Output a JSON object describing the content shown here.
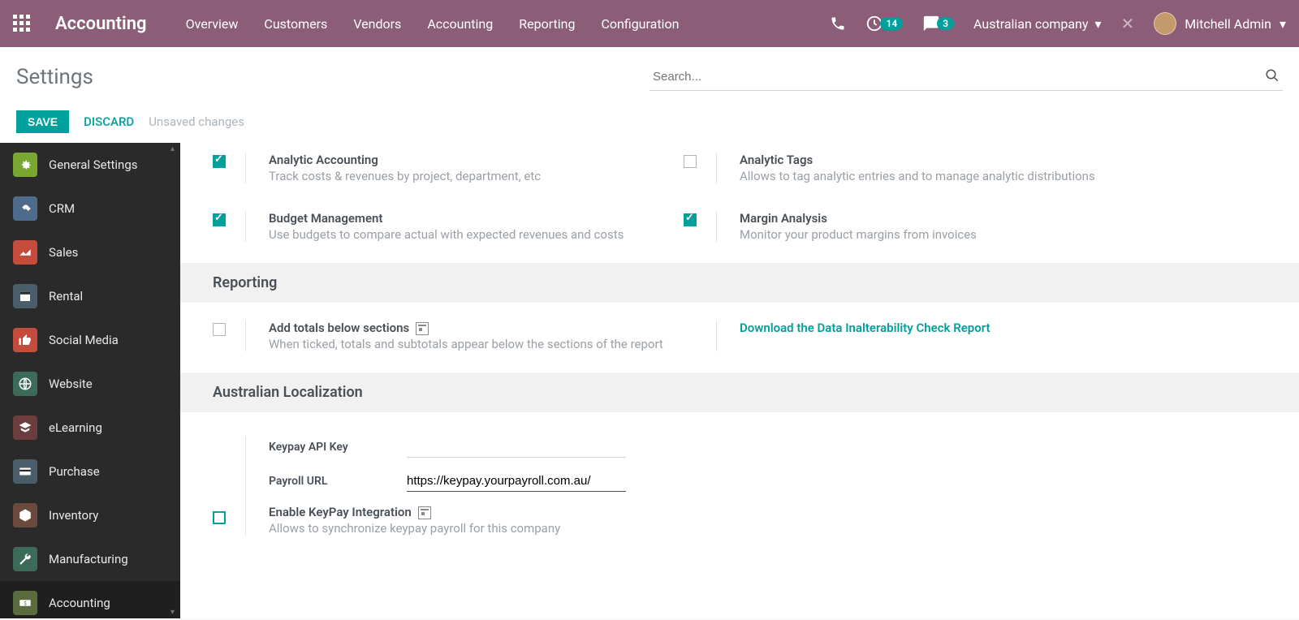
{
  "topbar": {
    "brand": "Accounting",
    "nav": [
      "Overview",
      "Customers",
      "Vendors",
      "Accounting",
      "Reporting",
      "Configuration"
    ],
    "clock_badge": "14",
    "chat_badge": "3",
    "company": "Australian company",
    "user": "Mitchell Admin"
  },
  "subhead": {
    "title": "Settings",
    "search_placeholder": "Search...",
    "save": "SAVE",
    "discard": "DISCARD",
    "unsaved": "Unsaved changes"
  },
  "sidebar": [
    {
      "label": "General Settings",
      "color": "#7aa732",
      "icon": "gear"
    },
    {
      "label": "CRM",
      "color": "#4e6b8c",
      "icon": "handshake"
    },
    {
      "label": "Sales",
      "color": "#c44c3d",
      "icon": "chart"
    },
    {
      "label": "Rental",
      "color": "#4a5d6b",
      "icon": "calendar"
    },
    {
      "label": "Social Media",
      "color": "#c44c3d",
      "icon": "thumb"
    },
    {
      "label": "Website",
      "color": "#3d6b5a",
      "icon": "globe"
    },
    {
      "label": "eLearning",
      "color": "#6b3d3d",
      "icon": "cap"
    },
    {
      "label": "Purchase",
      "color": "#4a5d6b",
      "icon": "card"
    },
    {
      "label": "Inventory",
      "color": "#6b4a3d",
      "icon": "box"
    },
    {
      "label": "Manufacturing",
      "color": "#3d6b5a",
      "icon": "wrench"
    },
    {
      "label": "Accounting",
      "color": "#5a6b3d",
      "icon": "money",
      "active": true
    }
  ],
  "settings": {
    "analytics": [
      {
        "label": "Analytic Accounting",
        "desc": "Track costs & revenues by project, department, etc",
        "checked": true
      },
      {
        "label": "Analytic Tags",
        "desc": "Allows to tag analytic entries and to manage analytic distributions",
        "checked": false
      },
      {
        "label": "Budget Management",
        "desc": "Use budgets to compare actual with expected revenues and costs",
        "checked": true
      },
      {
        "label": "Margin Analysis",
        "desc": "Monitor your product margins from invoices",
        "checked": true
      }
    ],
    "reporting_head": "Reporting",
    "reporting": {
      "totals_label": "Add totals below sections",
      "totals_desc": "When ticked, totals and subtotals appear below the sections of the report",
      "download_link": "Download the Data Inalterability Check Report"
    },
    "au_head": "Australian Localization",
    "au": {
      "api_key_label": "Keypay API Key",
      "payroll_url_label": "Payroll URL",
      "payroll_url_value": "https://keypay.yourpayroll.com.au/",
      "enable_label": "Enable KeyPay Integration",
      "enable_desc": "Allows to synchronize keypay payroll for this company"
    }
  }
}
